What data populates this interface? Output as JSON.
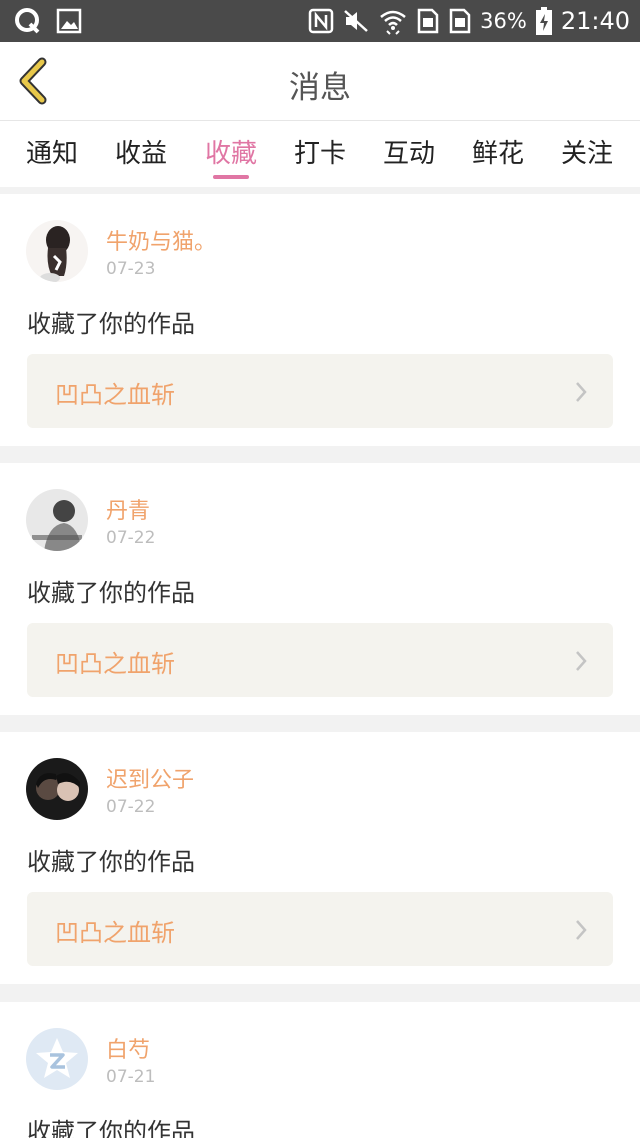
{
  "status_bar": {
    "battery": "36%",
    "time": "21:40",
    "icons": [
      "qq-icon",
      "image-icon",
      "nfc-icon",
      "mute-icon",
      "wifi-icon",
      "sim1-icon",
      "sim2-icon",
      "battery-charging-icon"
    ]
  },
  "header": {
    "title": "消息",
    "back_icon": "chevron-left-icon"
  },
  "tabs": {
    "items": [
      "通知",
      "收益",
      "收藏",
      "打卡",
      "互动",
      "鲜花",
      "关注"
    ],
    "active": "收藏",
    "active_color": "#e076a4"
  },
  "messages": [
    {
      "user": "牛奶与猫。",
      "date": "07-23",
      "action": "收藏了你的作品",
      "work": "凹凸之血斩"
    },
    {
      "user": "丹青",
      "date": "07-22",
      "action": "收藏了你的作品",
      "work": "凹凸之血斩"
    },
    {
      "user": "迟到公子",
      "date": "07-22",
      "action": "收藏了你的作品",
      "work": "凹凸之血斩"
    },
    {
      "user": "白芍",
      "date": "07-21",
      "action": "收藏了你的作品"
    }
  ],
  "colors": {
    "accent": "#f0a36c",
    "status_bar": "#4a4a4a",
    "back_icon": "#e8c84a"
  }
}
